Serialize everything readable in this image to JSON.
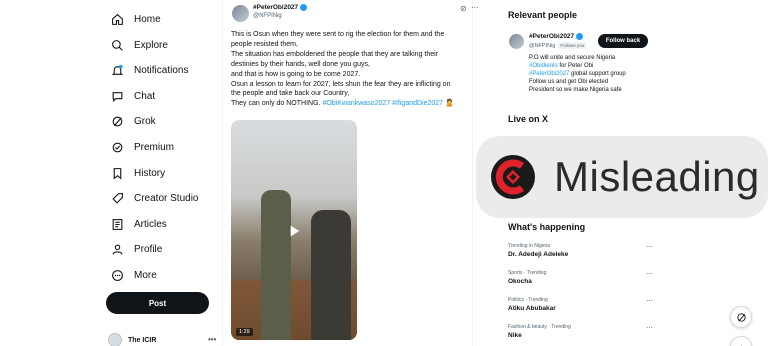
{
  "sidebar": {
    "items": [
      {
        "label": "Home",
        "icon": "home-icon"
      },
      {
        "label": "Explore",
        "icon": "search-icon"
      },
      {
        "label": "Notifications",
        "icon": "bell-icon"
      },
      {
        "label": "Chat",
        "icon": "chat-icon"
      },
      {
        "label": "Grok",
        "icon": "grok-icon"
      },
      {
        "label": "Premium",
        "icon": "premium-icon"
      },
      {
        "label": "History",
        "icon": "bookmark-icon"
      },
      {
        "label": "Creator Studio",
        "icon": "rocket-icon"
      },
      {
        "label": "Articles",
        "icon": "article-icon"
      },
      {
        "label": "Profile",
        "icon": "person-icon"
      },
      {
        "label": "More",
        "icon": "more-circle-icon"
      }
    ],
    "post_label": "Post",
    "account_name": "The ICIR",
    "account_more": "•••"
  },
  "tweet": {
    "name": "#PeterObi2027",
    "handle": "@NFPINig",
    "lines": [
      "This is Osun when they were sent to rig the election for them and the",
      "people resisted them,",
      "The situation has emboldened the people that they are talking their",
      "destinies by their hands, well done you guys,",
      "and that is how is going to be come 2027.",
      "Osun a lesson to learn for 2027, lets shun the fear they are inflicting on",
      "the people and take back our Country,"
    ],
    "last_line_prefix": "They can only do NOTHING.",
    "hashtags": "#ObiKwankwaso2027 #IfigandDie2027",
    "video_duration": "1:29"
  },
  "right": {
    "relevant_title": "Relevant people",
    "person": {
      "name": "#PeterObi2027",
      "handle": "@NFPINig",
      "follows_you": "Follows you",
      "follow_label": "Follow back",
      "bio_1": "P.O will unite and secure Nigeria",
      "bio_2_tag": "#Obidients",
      "bio_2_rest": " for Peter Obi",
      "bio_3_tag": "#PeterObi2027",
      "bio_3_rest": " global support group",
      "bio_4": "Follow us and get Obi elected",
      "bio_5": "President so we make Nigeria safe"
    },
    "live_title": "Live on X",
    "happening_title": "What's happening",
    "trends": [
      {
        "category": "Trending in Nigeria",
        "name": "Dr. Adedeji Adeleke"
      },
      {
        "category": "Sports · Trending",
        "name": "Okocha"
      },
      {
        "category": "Politics · Trending",
        "name": "Atiku Abubakar"
      },
      {
        "category": "Fashion & beauty · Trending",
        "name": "Nike"
      }
    ]
  },
  "banner": {
    "text": "Misleading",
    "logo_icon": "icir-logo-icon",
    "accent_color": "#e0222a"
  }
}
